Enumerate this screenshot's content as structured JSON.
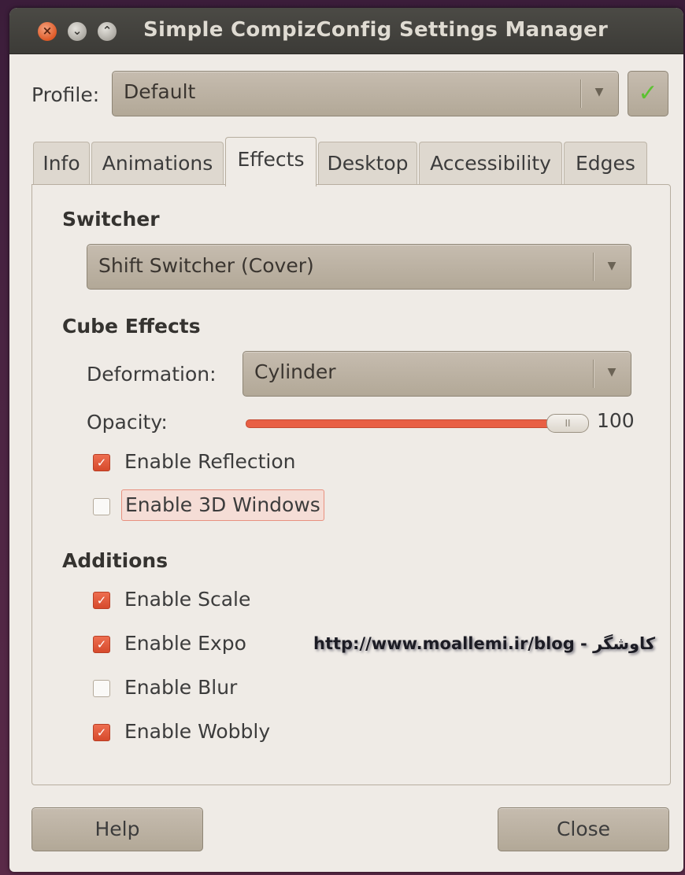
{
  "window": {
    "title": "Simple CompizConfig Settings Manager",
    "buttons": {
      "close": "×",
      "minimize": "⌄",
      "maximize": "⌃"
    }
  },
  "profile": {
    "label": "Profile:",
    "value": "Default",
    "apply_icon": "check-icon",
    "apply_symbol": "✓"
  },
  "tabs": [
    {
      "label": "Info",
      "active": false
    },
    {
      "label": "Animations",
      "active": false
    },
    {
      "label": "Effects",
      "active": true
    },
    {
      "label": "Desktop",
      "active": false
    },
    {
      "label": "Accessibility",
      "active": false
    },
    {
      "label": "Edges",
      "active": false
    }
  ],
  "switcher": {
    "title": "Switcher",
    "value": "Shift Switcher (Cover)"
  },
  "cube_effects": {
    "title": "Cube Effects",
    "deformation_label": "Deformation:",
    "deformation_value": "Cylinder",
    "opacity_label": "Opacity:",
    "opacity_value": "100",
    "opacity_level": 100,
    "enable_reflection": {
      "label": "Enable Reflection",
      "checked": true
    },
    "enable_3d_windows": {
      "label": "Enable 3D Windows",
      "checked": false
    }
  },
  "additions": {
    "title": "Additions",
    "items": [
      {
        "label": "Enable Scale",
        "checked": true
      },
      {
        "label": "Enable Expo",
        "checked": true
      },
      {
        "label": "Enable Blur",
        "checked": false
      },
      {
        "label": "Enable Wobbly",
        "checked": true
      }
    ]
  },
  "watermark": "http://www.moallemi.ir/blog - کاوشگر",
  "footer": {
    "help_label": "Help",
    "close_label": "Close"
  },
  "colors": {
    "accent": "#e85f44",
    "titlebar": "#3c3b37",
    "window_bg": "#efebe6",
    "check_green": "#5cc232"
  }
}
